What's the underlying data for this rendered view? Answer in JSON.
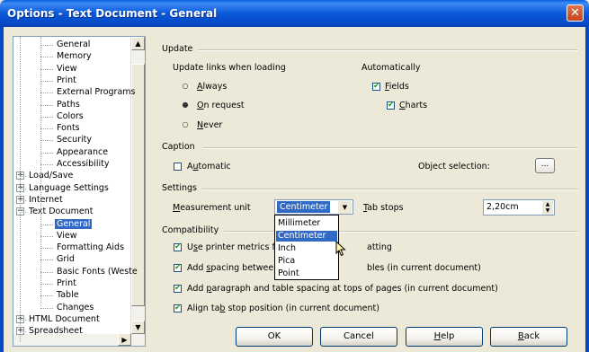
{
  "window": {
    "title": "Options - Text Document - General",
    "close_glyph": "✕"
  },
  "tree": {
    "items": [
      {
        "label": "General",
        "depth": 2
      },
      {
        "label": "Memory",
        "depth": 2
      },
      {
        "label": "View",
        "depth": 2
      },
      {
        "label": "Print",
        "depth": 2
      },
      {
        "label": "External Programs",
        "depth": 2
      },
      {
        "label": "Paths",
        "depth": 2
      },
      {
        "label": "Colors",
        "depth": 2
      },
      {
        "label": "Fonts",
        "depth": 2
      },
      {
        "label": "Security",
        "depth": 2
      },
      {
        "label": "Appearance",
        "depth": 2
      },
      {
        "label": "Accessibility",
        "depth": 2
      },
      {
        "label": "Load/Save",
        "depth": 1,
        "toggle": "+"
      },
      {
        "label": "Language Settings",
        "depth": 1,
        "toggle": "+"
      },
      {
        "label": "Internet",
        "depth": 1,
        "toggle": "+"
      },
      {
        "label": "Text Document",
        "depth": 1,
        "toggle": "−"
      },
      {
        "label": "General",
        "depth": 2,
        "selected": true
      },
      {
        "label": "View",
        "depth": 2
      },
      {
        "label": "Formatting Aids",
        "depth": 2
      },
      {
        "label": "Grid",
        "depth": 2
      },
      {
        "label": "Basic Fonts (Weste",
        "depth": 2
      },
      {
        "label": "Print",
        "depth": 2
      },
      {
        "label": "Table",
        "depth": 2
      },
      {
        "label": "Changes",
        "depth": 2
      },
      {
        "label": "HTML Document",
        "depth": 1,
        "toggle": "+"
      },
      {
        "label": "Spreadsheet",
        "depth": 1,
        "toggle": "+"
      }
    ]
  },
  "update": {
    "heading": "Update",
    "links_label": "Update links when loading",
    "options": [
      {
        "prefix": "",
        "key": "A",
        "rest": "lways",
        "selected": false
      },
      {
        "prefix": "",
        "key": "O",
        "rest": "n request",
        "selected": true
      },
      {
        "prefix": "",
        "key": "N",
        "rest": "ever",
        "selected": false
      }
    ],
    "auto_label": "Automatically",
    "fields": {
      "key": "F",
      "rest": "ields",
      "checked": true
    },
    "charts": {
      "key": "C",
      "rest": "harts",
      "checked": true
    }
  },
  "caption": {
    "heading": "Caption",
    "automatic": {
      "prefix": "A",
      "key": "u",
      "rest": "tomatic",
      "checked": false
    },
    "object_selection": "Object selection:",
    "browse": "..."
  },
  "settings": {
    "heading": "Settings",
    "measurement": {
      "prefix": "",
      "key": "M",
      "rest": "easurement unit"
    },
    "unit_value": "Centimeter",
    "unit_options": [
      {
        "label": "Millimeter",
        "highlighted": false
      },
      {
        "label": "Centimeter",
        "highlighted": true
      },
      {
        "label": "Inch",
        "highlighted": false
      },
      {
        "label": "Pica",
        "highlighted": false
      },
      {
        "label": "Point",
        "highlighted": false
      }
    ],
    "tab_stops": {
      "prefix": "",
      "key": "T",
      "rest": "ab stops"
    },
    "tab_value": "2,20cm"
  },
  "compatibility": {
    "heading": "Compatibility",
    "items": [
      {
        "pre": "U",
        "key": "s",
        "post": "e printer metrics f",
        "tail": "atting",
        "checked": true
      },
      {
        "pre": "Add ",
        "key": "s",
        "post": "pacing between",
        "tail": "bles (in current document)",
        "checked": true
      },
      {
        "pre": "Add ",
        "key": "p",
        "post": "aragraph and table spacing at tops of pages (in current document)",
        "tail": "",
        "checked": true
      },
      {
        "pre": "Align ta",
        "key": "b",
        "post": " stop position (in current document)",
        "tail": "",
        "checked": true
      }
    ]
  },
  "buttons": {
    "ok": "OK",
    "cancel": "Cancel",
    "help": {
      "key": "H",
      "rest": "elp"
    },
    "back": {
      "key": "B",
      "rest": "ack"
    }
  },
  "colors": {
    "titlebar": "#0a58d8",
    "selection": "#316ac5",
    "face": "#ece9d8"
  },
  "icons": {
    "checked": "✔",
    "radio_on": "●",
    "radio_off": "○",
    "plus": "+",
    "minus": "−",
    "arrow_down": "▼",
    "arrow_up": "▲",
    "arrow_right": "▶"
  }
}
